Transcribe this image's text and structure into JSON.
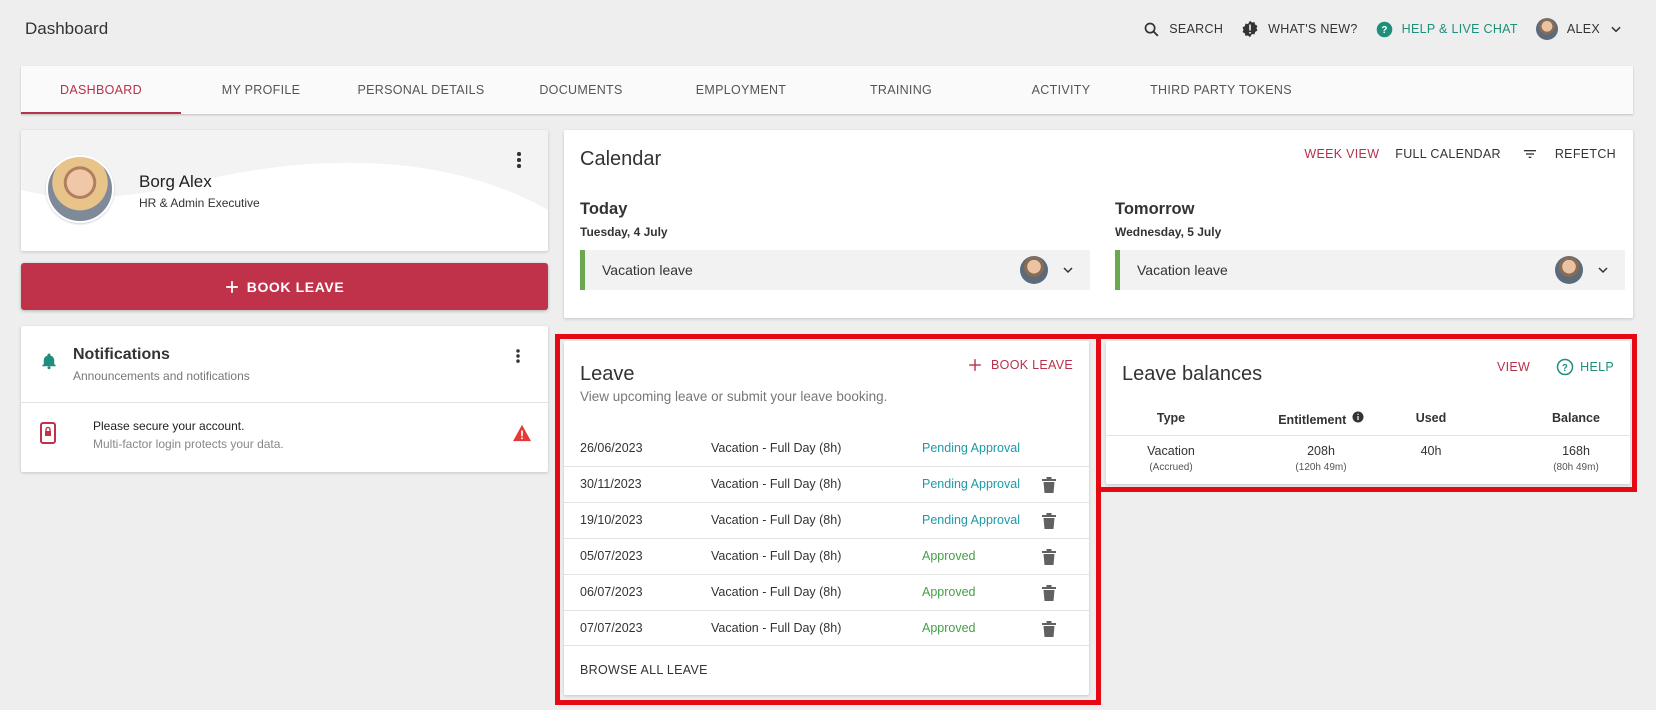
{
  "header": {
    "title": "Dashboard",
    "search_label": "SEARCH",
    "whats_new_label": "WHAT'S NEW?",
    "help_label": "HELP & LIVE CHAT",
    "user_label": "ALEX"
  },
  "tabs": [
    {
      "label": "DASHBOARD",
      "active": true
    },
    {
      "label": "MY PROFILE"
    },
    {
      "label": "PERSONAL DETAILS"
    },
    {
      "label": "DOCUMENTS"
    },
    {
      "label": "EMPLOYMENT"
    },
    {
      "label": "TRAINING"
    },
    {
      "label": "ACTIVITY"
    },
    {
      "label": "THIRD PARTY TOKENS"
    }
  ],
  "profile": {
    "name": "Borg Alex",
    "role": "HR & Admin Executive"
  },
  "book_leave_button": "BOOK LEAVE",
  "notifications": {
    "title": "Notifications",
    "subtitle": "Announcements and notifications",
    "item_title": "Please secure your account.",
    "item_sub": "Multi-factor login protects your data."
  },
  "calendar": {
    "title": "Calendar",
    "week_view": "WEEK VIEW",
    "full_calendar": "FULL CALENDAR",
    "refetch": "REFETCH",
    "today": {
      "heading": "Today",
      "date": "Tuesday, 4 July",
      "event": "Vacation leave"
    },
    "tomorrow": {
      "heading": "Tomorrow",
      "date": "Wednesday, 5 July",
      "event": "Vacation leave"
    }
  },
  "leave": {
    "title": "Leave",
    "subtitle": "View upcoming leave or submit your leave booking.",
    "book_label": "BOOK LEAVE",
    "rows": [
      {
        "date": "26/06/2023",
        "type": "Vacation - Full Day (8h)",
        "status": "Pending Approval",
        "deletable": false
      },
      {
        "date": "30/11/2023",
        "type": "Vacation - Full Day (8h)",
        "status": "Pending Approval",
        "deletable": true
      },
      {
        "date": "19/10/2023",
        "type": "Vacation - Full Day (8h)",
        "status": "Pending Approval",
        "deletable": true
      },
      {
        "date": "05/07/2023",
        "type": "Vacation - Full Day (8h)",
        "status": "Approved",
        "deletable": true
      },
      {
        "date": "06/07/2023",
        "type": "Vacation - Full Day (8h)",
        "status": "Approved",
        "deletable": true
      },
      {
        "date": "07/07/2023",
        "type": "Vacation - Full Day (8h)",
        "status": "Approved",
        "deletable": true
      }
    ],
    "browse_label": "BROWSE ALL LEAVE"
  },
  "balances": {
    "title": "Leave balances",
    "view_label": "VIEW",
    "help_label": "HELP",
    "headers": {
      "type": "Type",
      "entitlement": "Entitlement",
      "used": "Used",
      "balance": "Balance"
    },
    "row": {
      "type": "Vacation",
      "type_sub": "(Accrued)",
      "entitlement": "208h",
      "entitlement_sub": "(120h 49m)",
      "used": "40h",
      "balance": "168h",
      "balance_sub": "(80h 49m)"
    }
  },
  "colors": {
    "accent": "#c0324a",
    "teal": "#1e8f7a",
    "pending": "#1a9ba8",
    "approved": "#43a047",
    "highlight": "#e50914"
  }
}
